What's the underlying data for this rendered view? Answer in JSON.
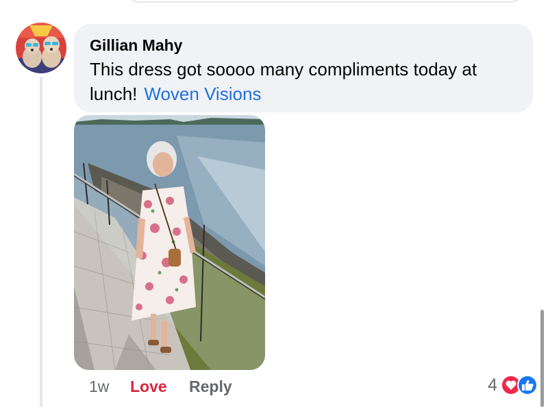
{
  "comment": {
    "author": "Gillian Mahy",
    "text": "This dress got soooo many compliments today at lunch!",
    "mention": "Woven Visions",
    "timestamp": "1w",
    "love_label": "Love",
    "reply_label": "Reply",
    "reaction_count": "4",
    "reactions": [
      "love-reaction-icon",
      "like-reaction-icon"
    ]
  },
  "colors": {
    "bubble": "#f0f2f5",
    "love": "#d9263a",
    "link": "#216fdb",
    "meta": "#65676b",
    "like": "#1877f2"
  }
}
